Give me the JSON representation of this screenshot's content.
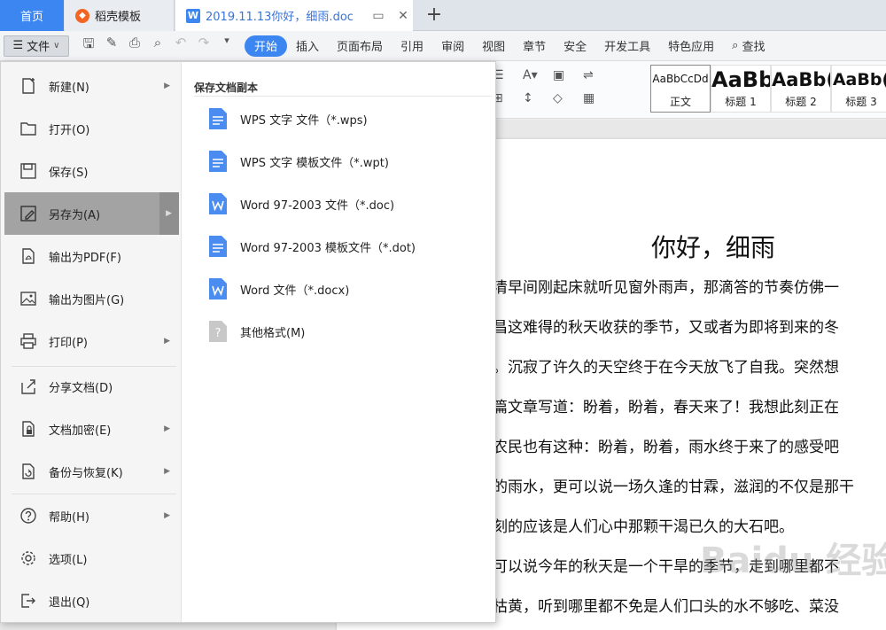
{
  "tabs": {
    "home": "首页",
    "template": "稻壳模板",
    "doc": "2019.11.13你好，细雨.doc"
  },
  "toolbar": {
    "file_label": "文件",
    "ribbon_tabs": [
      "开始",
      "插入",
      "页面布局",
      "引用",
      "审阅",
      "视图",
      "章节",
      "安全",
      "开发工具",
      "特色应用"
    ],
    "search_label": "查找"
  },
  "styles": [
    {
      "sample": "AaBbCcDd",
      "name": "正文"
    },
    {
      "sample": "AaBb",
      "name": "标题 1"
    },
    {
      "sample": "AaBb(",
      "name": "标题 2"
    },
    {
      "sample": "AaBb(",
      "name": "标题 3"
    }
  ],
  "file_menu": {
    "items": [
      {
        "label": "新建(N)",
        "icon": "new-doc-icon"
      },
      {
        "label": "打开(O)",
        "icon": "folder-icon"
      },
      {
        "label": "保存(S)",
        "icon": "save-icon"
      },
      {
        "label": "另存为(A)",
        "icon": "save-as-icon"
      },
      {
        "label": "输出为PDF(F)",
        "icon": "pdf-icon"
      },
      {
        "label": "输出为图片(G)",
        "icon": "image-icon"
      },
      {
        "label": "打印(P)",
        "icon": "print-icon"
      },
      {
        "label": "分享文档(D)",
        "icon": "share-icon"
      },
      {
        "label": "文档加密(E)",
        "icon": "lock-doc-icon"
      },
      {
        "label": "备份与恢复(K)",
        "icon": "backup-icon"
      },
      {
        "label": "帮助(H)",
        "icon": "help-icon"
      },
      {
        "label": "选项(L)",
        "icon": "gear-icon"
      },
      {
        "label": "退出(Q)",
        "icon": "exit-icon"
      }
    ],
    "submenu_title": "保存文档副本",
    "submenu_items": [
      {
        "label": "WPS 文字 文件（*.wps)",
        "icon": "wps-file-icon"
      },
      {
        "label": "WPS 文字 模板文件（*.wpt)",
        "icon": "wps-template-icon"
      },
      {
        "label": "Word 97-2003 文件（*.doc)",
        "icon": "word-file-icon"
      },
      {
        "label": "Word 97-2003 模板文件（*.dot)",
        "icon": "word-template-icon"
      },
      {
        "label": "Word 文件（*.docx)",
        "icon": "word-docx-icon"
      },
      {
        "label": "其他格式(M)",
        "icon": "unknown-format-icon"
      }
    ]
  },
  "document": {
    "title": "你好，细雨",
    "lines": [
      "清早间刚起床就听见窗外雨声，那滴答的节奏仿佛一",
      "昌这难得的秋天收获的季节，又或者为即将到来的冬",
      "。沉寂了许久的天空终于在今天放飞了自我。突然想",
      "篇文章写道：盼着，盼着，春天来了！我想此刻正在",
      "农民也有这种：盼着，盼着，雨水终于来了的感受吧",
      "的雨水，更可以说一场久逢的甘霖，滋润的不仅是那干",
      "刻的应该是人们心中那颗干渴已久的大石吧。",
      "可以说今年的秋天是一个干旱的季节，走到哪里都不",
      "枯黄，听到哪里都不免是人们口头的水不够吃、菜没"
    ],
    "watermark": "Baidu 经验"
  },
  "colors": {
    "accent": "#3b86f0",
    "menu_active": "#a3a3a3"
  }
}
